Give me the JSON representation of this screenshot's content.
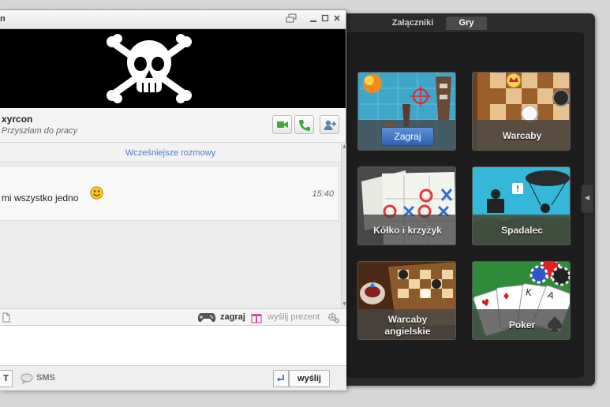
{
  "chat": {
    "title_fragment": "n",
    "contact_name": "xyrcon",
    "contact_status": "Przyszłam do pracy",
    "earlier_conversations": "Wcześniejsze rozmowy",
    "message": {
      "text": "mi wszystko jedno",
      "time": "15:40"
    },
    "toolbar": {
      "play_label": "zagraj",
      "gift_label": "wyślij prezent"
    },
    "bottom": {
      "t_label": "T",
      "sms_label": "SMS",
      "send_label": "wyślij"
    }
  },
  "panel": {
    "tabs": [
      {
        "label": "Załączniki",
        "active": false
      },
      {
        "label": "Gry",
        "active": true
      }
    ],
    "games": [
      {
        "label": "Zagraj",
        "kind": "play-button"
      },
      {
        "label": "Warcaby"
      },
      {
        "label": "Kółko i krzyżyk"
      },
      {
        "label": "Spadalec"
      },
      {
        "label": "Warcaby",
        "label2": "angielskie"
      },
      {
        "label": "Poker"
      }
    ]
  },
  "colors": {
    "accent_blue": "#4a7ec7",
    "play_button": "#3a6fc4",
    "panel_bg": "#2b2b2b",
    "green_button": "#3aa83a"
  }
}
